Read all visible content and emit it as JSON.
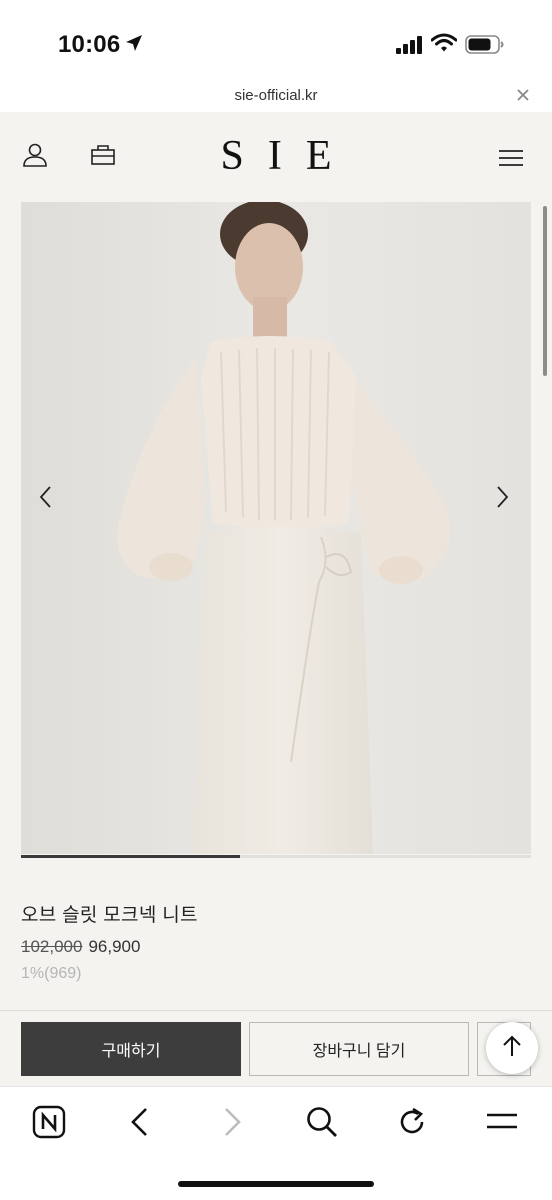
{
  "status_bar": {
    "time": "10:06",
    "icons": [
      "location-arrow-icon",
      "signal-icon",
      "wifi-icon",
      "battery-icon"
    ]
  },
  "browser": {
    "url": "sie-official.kr",
    "close_icon": "close-icon"
  },
  "header": {
    "logo": "SIE",
    "left_icons": [
      "user-icon",
      "bag-icon"
    ],
    "right_icon": "menu-icon"
  },
  "product": {
    "name": "오브 슬릿 모크넥 니트",
    "original_price": "102,000",
    "sale_price": "96,900",
    "discount": "1%(969)",
    "image_progress": 0.43
  },
  "actions": {
    "buy_label": "구매하기",
    "cart_label": "장바구니 담기"
  },
  "toolbar": {
    "icons": [
      "naver-home-icon",
      "back-icon",
      "forward-icon",
      "search-icon",
      "reload-icon",
      "menu-icon"
    ]
  },
  "colors": {
    "background": "#f4f3ef",
    "buy_button": "#3d3d3d",
    "text": "#222222"
  }
}
